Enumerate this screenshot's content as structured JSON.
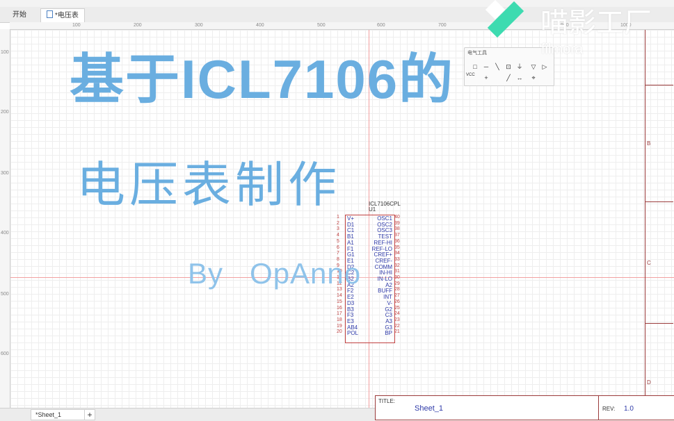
{
  "tabs": [
    {
      "label": "开始"
    },
    {
      "label": "*电压表"
    }
  ],
  "ruler_top": [
    "100",
    "200",
    "300",
    "400",
    "500",
    "600",
    "700",
    "800",
    "900",
    "1000"
  ],
  "ruler_left": [
    "100",
    "200",
    "300",
    "400",
    "500",
    "600"
  ],
  "overlay": {
    "title_line1": "基于ICL7106的",
    "title_line2": "电压表制作",
    "byline": "By   OpAnno"
  },
  "watermark": {
    "brand": "喵影工厂",
    "sub": "filmora"
  },
  "palette": {
    "title": "电气工具",
    "label_vcc": "VCC"
  },
  "component": {
    "name": "ICL7106CPL",
    "ref": "U1",
    "left_pins": [
      "V+",
      "D1",
      "C1",
      "B1",
      "A1",
      "F1",
      "G1",
      "E1",
      "D2",
      "C2",
      "B2",
      "A2",
      "F2",
      "E2",
      "D3",
      "B3",
      "F3",
      "E3",
      "AB4",
      "POL"
    ],
    "left_nums": [
      "1",
      "2",
      "3",
      "4",
      "5",
      "6",
      "7",
      "8",
      "9",
      "10",
      "11",
      "12",
      "13",
      "14",
      "15",
      "16",
      "17",
      "18",
      "19",
      "20"
    ],
    "right_pins": [
      "OSC1",
      "OSC2",
      "OSC3",
      "TEST",
      "REF-HI",
      "REF-LO",
      "CREF+",
      "CREF-",
      "COMM",
      "IN-HI",
      "IN-LO",
      "A2",
      "BUFF",
      "INT",
      "V-",
      "G2",
      "C3",
      "A3",
      "G3",
      "BP"
    ],
    "right_nums": [
      "40",
      "39",
      "38",
      "37",
      "36",
      "35",
      "34",
      "33",
      "32",
      "31",
      "30",
      "29",
      "28",
      "27",
      "26",
      "25",
      "24",
      "23",
      "22",
      "21"
    ]
  },
  "frame_zones": [
    "B",
    "C",
    "D"
  ],
  "title_block": {
    "title_label": "TITLE:",
    "title_value": "Sheet_1",
    "rev_label": "REV:",
    "rev_value": "1.0"
  },
  "sheet_tabs": [
    {
      "label": "*Sheet_1"
    }
  ],
  "add_sheet_label": "+"
}
